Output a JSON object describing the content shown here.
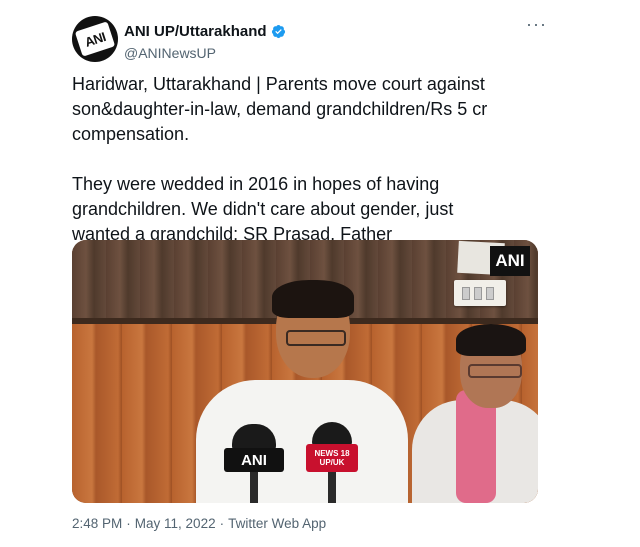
{
  "author": {
    "display_name": "ANI UP/Uttarakhand",
    "handle": "@ANINewsUP",
    "avatar_text": "ANI",
    "verified_icon": "verified-badge-icon"
  },
  "menu": {
    "more_label": "···"
  },
  "tweet": {
    "text": "Haridwar, Uttarakhand | Parents move court against\nson&daughter-in-law, demand grandchildren/Rs 5 cr\ncompensation.\n\nThey were wedded in 2016 in hopes of having\ngrandchildren. We didn't care about gender, just\nwanted a grandchild: SR Prasad, Father"
  },
  "media": {
    "watermark": "ANI",
    "mic_left_label": "ANI",
    "mic_right_label": "NEWS 18 UP/UK"
  },
  "meta": {
    "time": "2:48 PM",
    "separator1": "·",
    "date": "May 11, 2022",
    "separator2": "·",
    "source": "Twitter Web App"
  },
  "colors": {
    "text_primary": "#0f1419",
    "text_secondary": "#536471",
    "verified_blue": "#1d9bf0"
  }
}
